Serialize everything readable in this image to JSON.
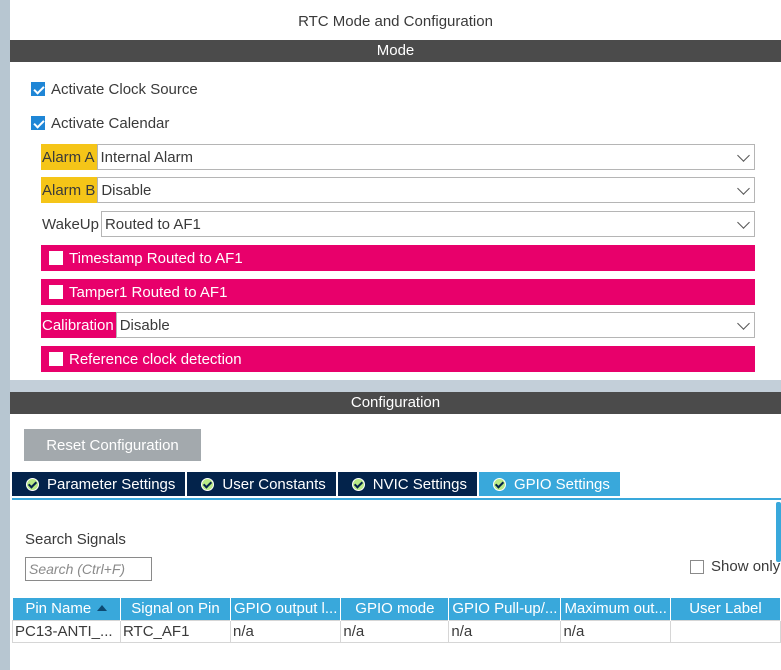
{
  "panel": {
    "title": "RTC Mode and Configuration"
  },
  "mode": {
    "header": "Mode",
    "activate_clock_source": {
      "label": "Activate Clock Source",
      "checked": true
    },
    "activate_calendar": {
      "label": "Activate Calendar",
      "checked": true
    },
    "alarm_a": {
      "label": "Alarm A",
      "value": "Internal Alarm"
    },
    "alarm_b": {
      "label": "Alarm B",
      "value": "Disable"
    },
    "wakeup": {
      "label": "WakeUp",
      "value": "Routed to AF1"
    },
    "timestamp": {
      "label": "Timestamp Routed to AF1",
      "checked": false
    },
    "tamper1": {
      "label": "Tamper1 Routed to AF1",
      "checked": false
    },
    "calibration": {
      "label": "Calibration",
      "value": "Disable"
    },
    "reference_clock": {
      "label": "Reference clock detection",
      "checked": false
    }
  },
  "configuration": {
    "header": "Configuration",
    "reset_label": "Reset Configuration",
    "tabs": [
      {
        "label": "Parameter Settings",
        "active": false
      },
      {
        "label": "User Constants",
        "active": false
      },
      {
        "label": "NVIC Settings",
        "active": false
      },
      {
        "label": "GPIO Settings",
        "active": true
      }
    ],
    "search_label": "Search Signals",
    "search_placeholder": "Search (Ctrl+F)",
    "show_only_label": "Show only",
    "table": {
      "headers": [
        "Pin Name",
        "Signal on Pin",
        "GPIO output l...",
        "GPIO mode",
        "GPIO Pull-up/...",
        "Maximum out...",
        "User Label"
      ],
      "rows": [
        [
          "PC13-ANTI_...",
          "RTC_AF1",
          "n/a",
          "n/a",
          "n/a",
          "n/a",
          ""
        ]
      ]
    }
  },
  "colors": {
    "accent_blue": "#39a8db",
    "dark_tab": "#03234b",
    "pink": "#e8006b",
    "yellow": "#f5c518",
    "section_bar": "#4b4b4b"
  }
}
